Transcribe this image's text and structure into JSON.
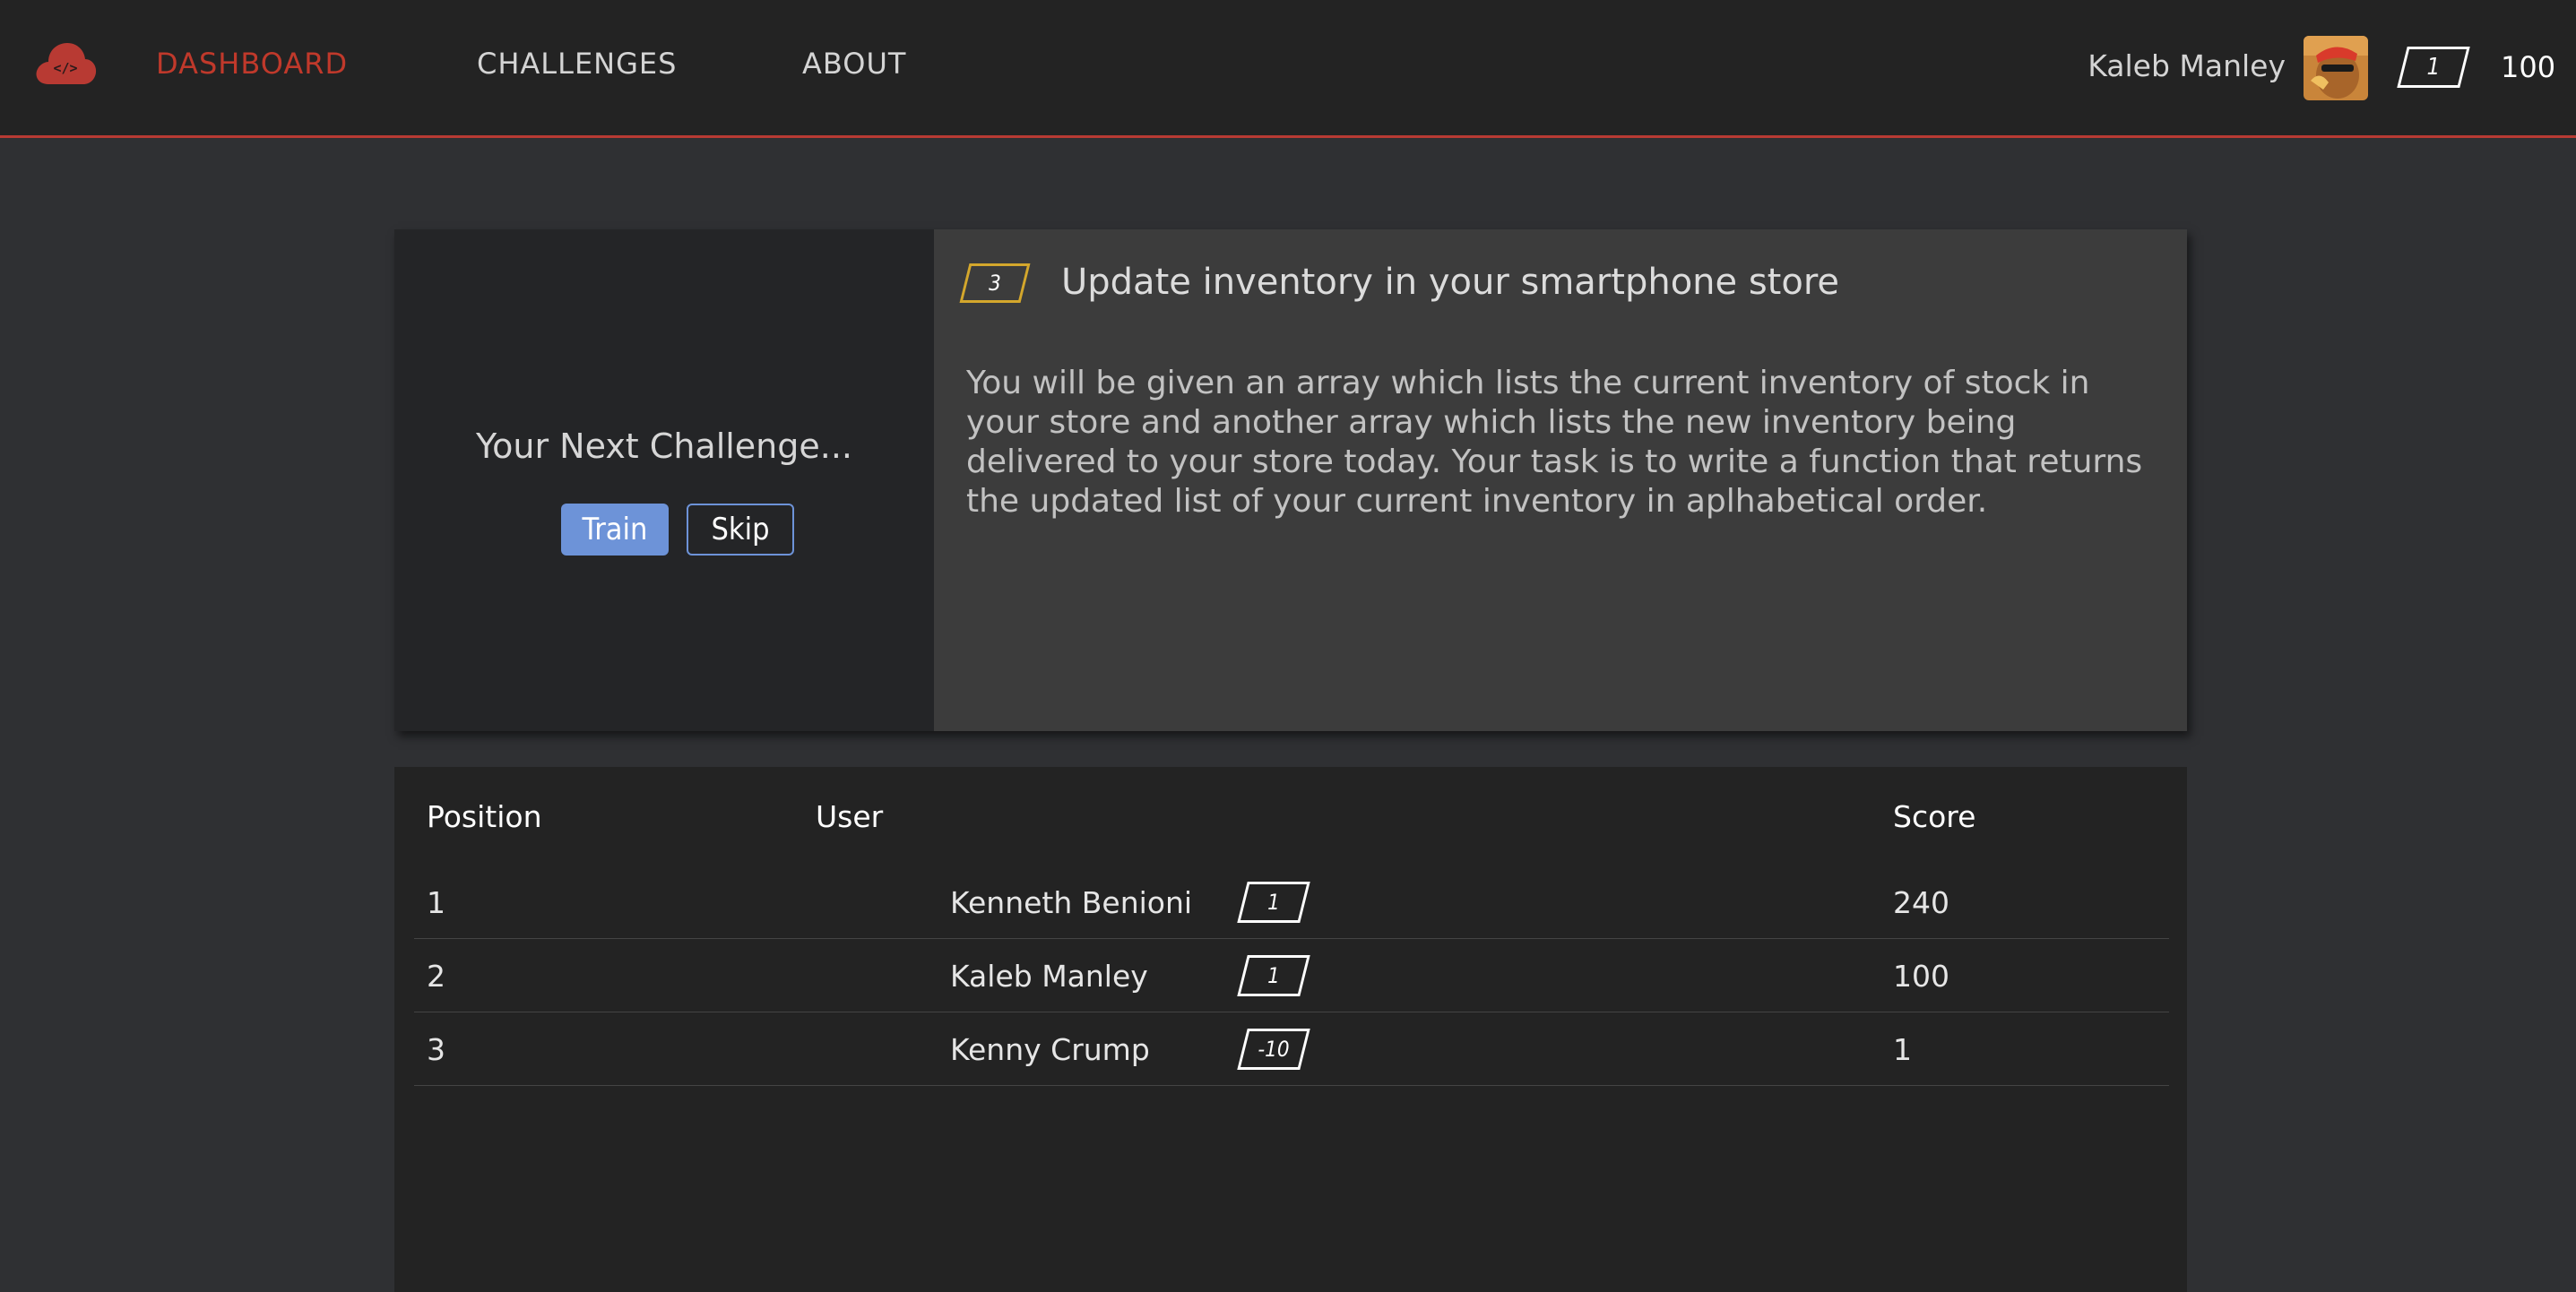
{
  "nav": {
    "links": [
      "DASHBOARD",
      "CHALLENGES",
      "ABOUT"
    ],
    "active": "DASHBOARD",
    "user_name": "Kaleb Manley",
    "user_rank": "1",
    "user_score": "100",
    "logo_icon": "cloud-code-icon",
    "accent_color": "#c0392b"
  },
  "challenge": {
    "heading": "Your Next Challenge...",
    "train_label": "Train",
    "skip_label": "Skip",
    "level": "3",
    "title": "Update inventory in your smartphone store",
    "description": "You will be given an array which lists the current inventory of stock in your store and another array which lists the new inventory being delivered to your store today. Your task is to write a function that returns the updated list of your current inventory in aplhabetical order."
  },
  "leaderboard": {
    "headers": {
      "position": "Position",
      "user": "User",
      "score": "Score"
    },
    "rows": [
      {
        "position": "1",
        "rank": "1",
        "user": "Kenneth Benioni",
        "score": "240"
      },
      {
        "position": "2",
        "rank": "1",
        "user": "Kaleb Manley",
        "score": "100"
      },
      {
        "position": "3",
        "rank": "-10",
        "user": "Kenny Crump",
        "score": "1"
      }
    ]
  }
}
